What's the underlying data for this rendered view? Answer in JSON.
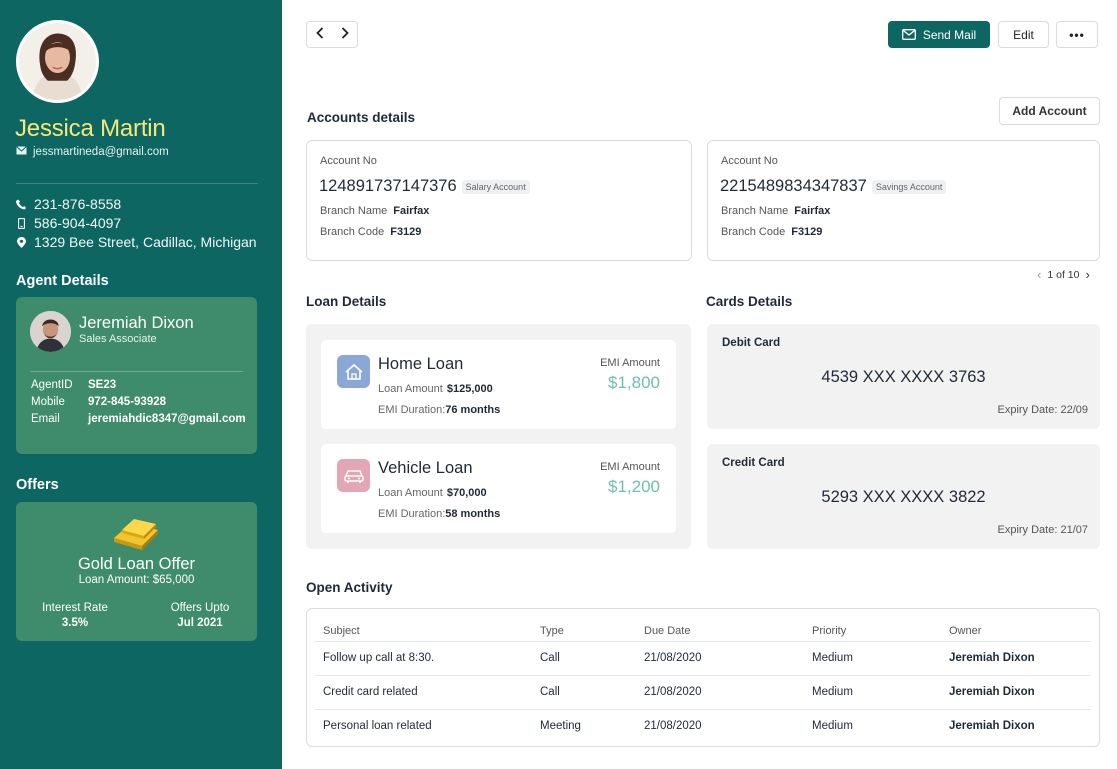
{
  "profile": {
    "name": "Jessica Martin",
    "email": "jessmartineda@gmail.com",
    "phone": "231-876-8558",
    "mobile": "586-904-4097",
    "address": "1329  Bee Street, Cadillac, Michigan"
  },
  "agent": {
    "section_title": "Agent Details",
    "name": "Jeremiah Dixon",
    "role": "Sales Associate",
    "id_label": "AgentID",
    "id_value": "SE23",
    "mobile_label": "Mobile",
    "mobile_value": "972-845-93928",
    "email_label": "Email",
    "email_value": "jeremiahdic8347@gmail.com"
  },
  "offers": {
    "section_title": "Offers",
    "title": "Gold Loan Offer",
    "amount": "Loan Amount: $65,000",
    "rate_label": "Interest Rate",
    "rate_value": "3.5%",
    "upto_label": "Offers Upto",
    "upto_value": "Jul 2021"
  },
  "toolbar": {
    "send_mail": "Send Mail",
    "edit": "Edit",
    "more": "•••"
  },
  "accounts": {
    "title": "Accounts details",
    "add_button": "Add Account",
    "no_label": "Account No",
    "branch_name_label": "Branch Name",
    "branch_code_label": "Branch Code",
    "items": [
      {
        "number": "124891737147376",
        "type": "Salary Account",
        "branch_name": "Fairfax",
        "branch_code": "F3129"
      },
      {
        "number": "2215489834347837",
        "type": "Savings Account",
        "branch_name": "Fairfax",
        "branch_code": "F3129"
      }
    ],
    "pager": "1 of 10"
  },
  "loans": {
    "title": "Loan Details",
    "amount_label": "Loan Amount",
    "duration_label": "EMI Duration:",
    "emi_label": "EMI Amount",
    "items": [
      {
        "name": "Home Loan",
        "amount": "$125,000",
        "duration": "76 months",
        "emi": "$1,800",
        "icon": "house-icon",
        "color": "#8aa7d6"
      },
      {
        "name": "Vehicle Loan",
        "amount": "$70,000",
        "duration": "58 months",
        "emi": "$1,200",
        "icon": "car-icon",
        "color": "#e3a6b4"
      }
    ]
  },
  "cards": {
    "title": "Cards Details",
    "items": [
      {
        "title": "Debit Card",
        "number": "4539 XXX XXXX 3763",
        "expiry": "Expiry Date: 22/09"
      },
      {
        "title": "Credit Card",
        "number": "5293 XXX XXXX 3822",
        "expiry": "Expiry Date: 21/07"
      }
    ]
  },
  "activity": {
    "title": "Open Activity",
    "columns": [
      "Subject",
      "Type",
      "Due Date",
      "Priority",
      "Owner"
    ],
    "rows": [
      [
        "Follow up call at 8:30.",
        "Call",
        "21/08/2020",
        "Medium",
        "Jeremiah Dixon"
      ],
      [
        "Credit card related",
        "Call",
        "21/08/2020",
        "Medium",
        "Jeremiah Dixon"
      ],
      [
        "Personal loan related",
        "Meeting",
        "21/08/2020",
        "Medium",
        "Jeremiah Dixon"
      ]
    ]
  },
  "colors": {
    "sidebar": "#0d6662",
    "card_green": "#3e8c6b",
    "name_yellow": "#f6e87a",
    "emi_teal": "#6dbfae"
  }
}
